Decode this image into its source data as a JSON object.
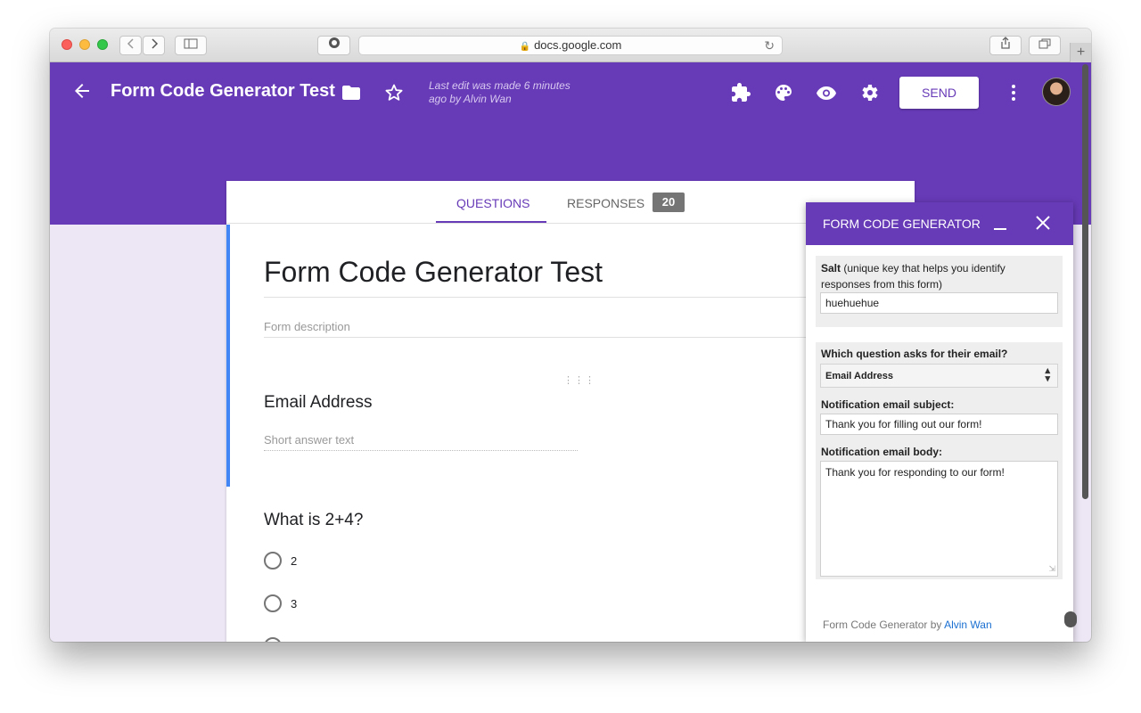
{
  "browser": {
    "url": "docs.google.com",
    "back_icon": "chevron-left-icon",
    "forward_icon": "chevron-right-icon",
    "new_tab_label": "+"
  },
  "header": {
    "title": "Form Code Generator Test",
    "last_edit": "Last edit was made 6 minutes ago by Alvin Wan",
    "send_label": "SEND",
    "accent": "#673ab7"
  },
  "tabs": {
    "questions": "QUESTIONS",
    "responses": "RESPONSES",
    "responses_count": "20"
  },
  "form": {
    "title": "Form Code Generator Test",
    "description_placeholder": "Form description",
    "questions": [
      {
        "title": "Email Address",
        "placeholder": "Short answer text"
      },
      {
        "title": "What is 2+4?",
        "options": [
          "2",
          "3"
        ]
      }
    ]
  },
  "addon": {
    "title": "FORM CODE GENERATOR",
    "salt_label_bold": "Salt",
    "salt_label_rest": " (unique key that helps you identify responses from this form)",
    "salt_value": "huehuehue",
    "email_question_label": "Which question asks for their email?",
    "email_question_value": "Email Address",
    "subject_label": "Notification email subject:",
    "subject_value": "Thank you for filling out our form!",
    "body_label": "Notification email body:",
    "body_value": "Thank you for responding to our form!",
    "footer_text": "Form Code Generator by ",
    "footer_link": "Alvin Wan"
  }
}
